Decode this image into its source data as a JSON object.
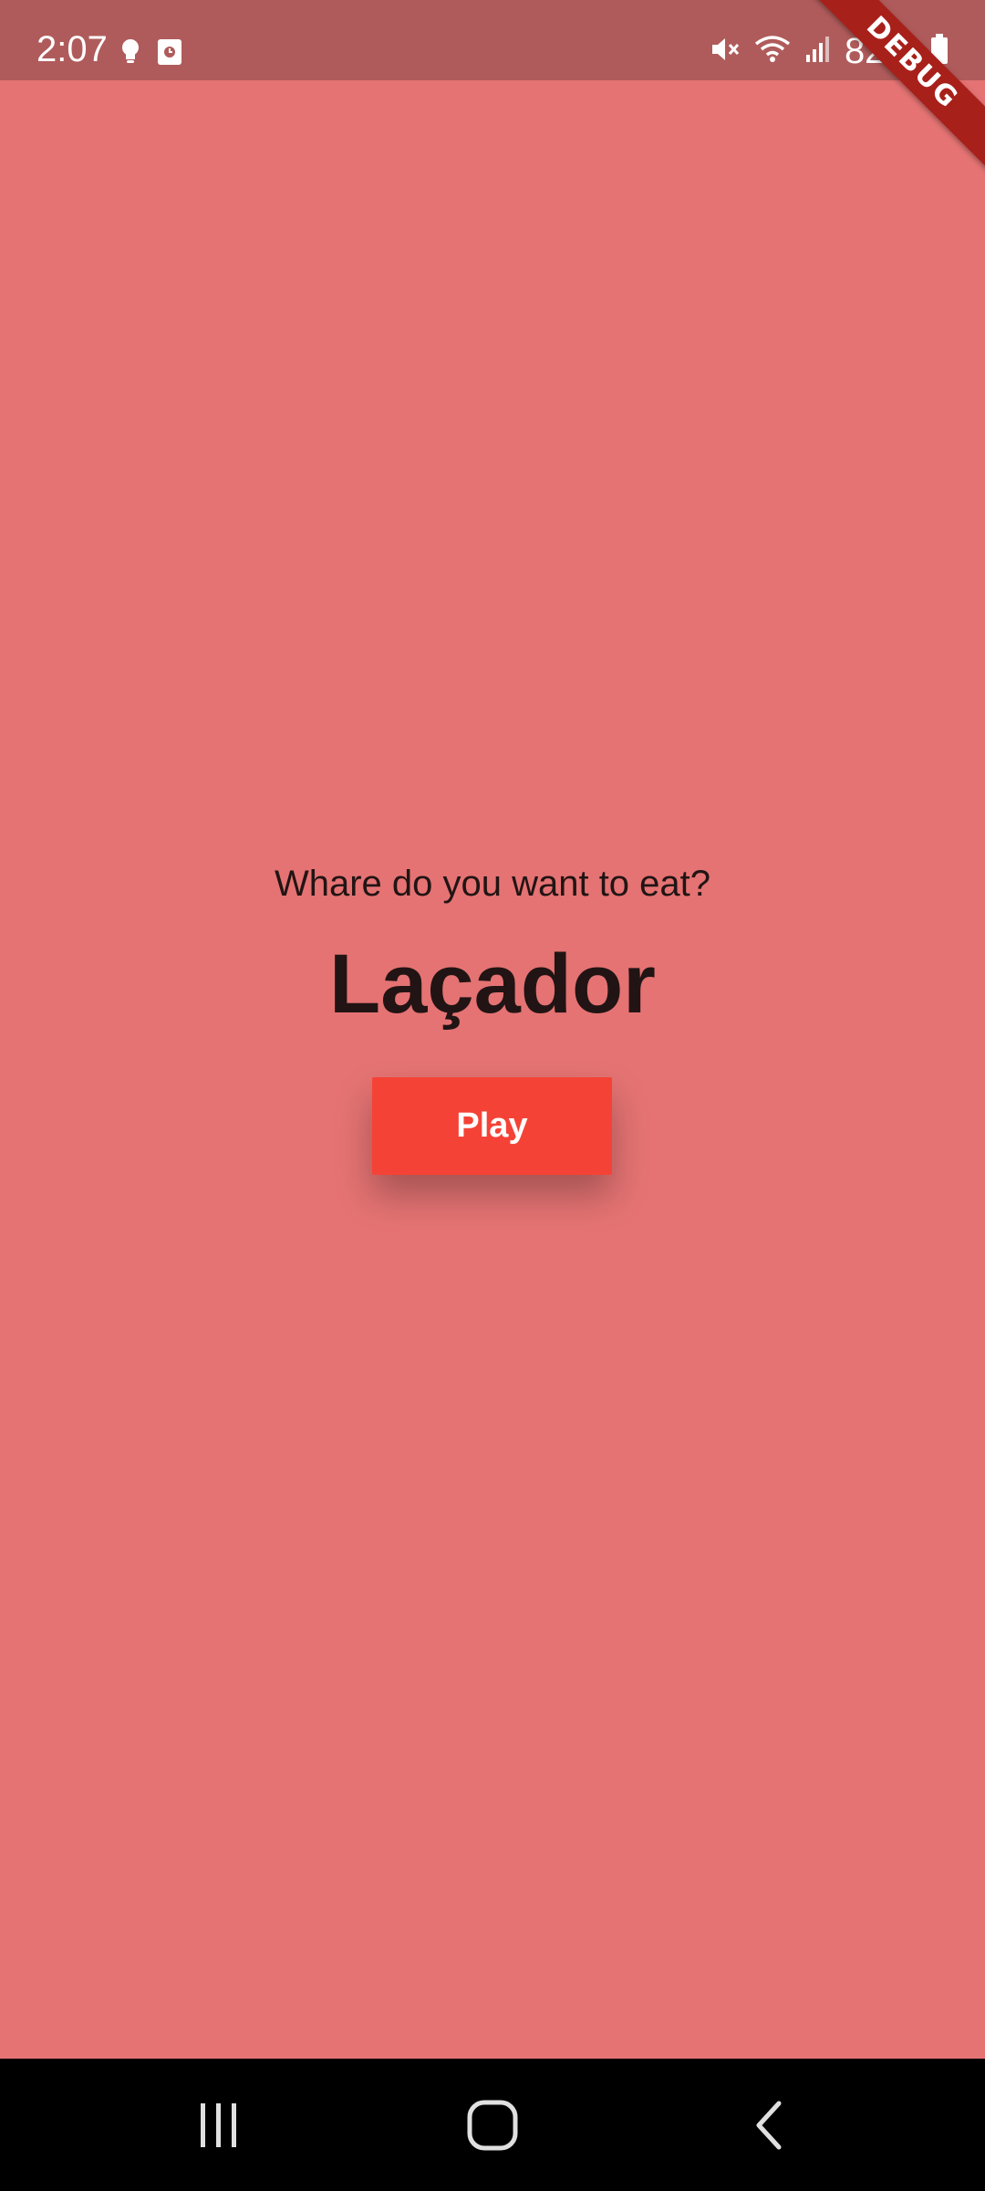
{
  "status_bar": {
    "time": "2:07",
    "battery": "82%",
    "icons": [
      "lightbulb-icon",
      "calendar-icon",
      "mute-icon",
      "wifi-icon",
      "signal-icon",
      "battery-icon"
    ]
  },
  "debug_banner": {
    "label": "DEBUG"
  },
  "main": {
    "question": "Whare do you want to eat?",
    "food_name": "Laçador",
    "play_label": "Play"
  },
  "colors": {
    "background": "#e57373",
    "status_bar": "#b05b5b",
    "button": "#f44336",
    "text": "#221414",
    "nav_bar": "#000000"
  },
  "nav_bar": {
    "buttons": [
      "recent-apps-icon",
      "home-icon",
      "back-icon"
    ]
  }
}
